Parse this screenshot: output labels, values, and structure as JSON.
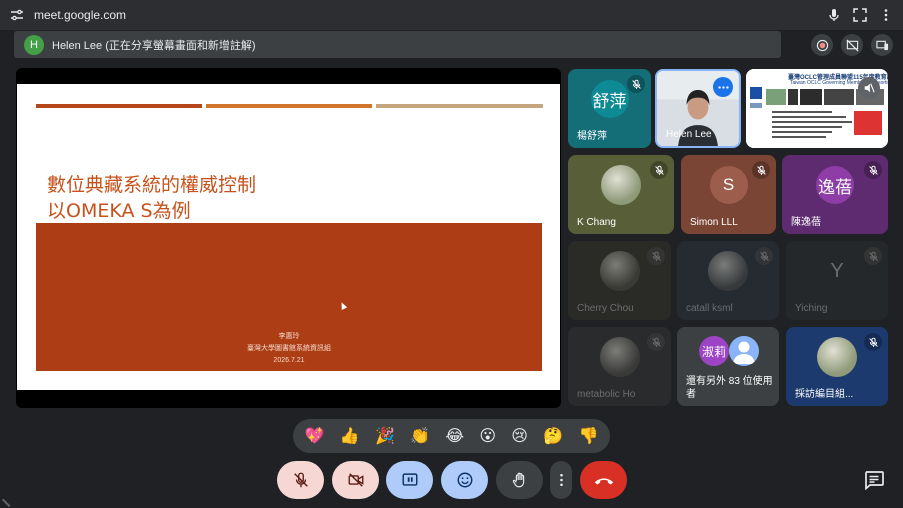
{
  "browser": {
    "url": "meet.google.com"
  },
  "banner": {
    "avatar_letter": "H",
    "text": "Helen Lee (正在分享螢幕畫面和新增註解)"
  },
  "slide": {
    "title_line1": "數位典藏系統的權威控制",
    "title_line2": "以OMEKA S為例",
    "author": "李惠玲",
    "org": "臺灣大學圖書館系統資訊組",
    "date": "2026.7.21",
    "bar_colors": [
      "#b5461b",
      "#d0752a",
      "#c4a57e"
    ]
  },
  "tiles": [
    {
      "id": "tile-1",
      "name": "楊舒萍",
      "letter": "舒萍",
      "bg": "#136e78",
      "avatar_color": "#0e8a94",
      "state": "muted"
    },
    {
      "id": "tile-2",
      "name": "Helen Lee",
      "state": "speaking"
    },
    {
      "id": "tile-3",
      "name": "",
      "state": "screen",
      "screen_title": "臺灣OCLC管理成員聯盟115年度教育訓練",
      "screen_subtitle": "Taiwan OCLC Governing Members Consortium"
    },
    {
      "id": "tile-4",
      "name": "K Chang",
      "bg": "#585e37",
      "state": "muted"
    },
    {
      "id": "tile-5",
      "name": "Simon LLL",
      "letter": "S",
      "bg": "#7a4535",
      "avatar_color": "#9c5d4c",
      "state": "muted"
    },
    {
      "id": "tile-6",
      "name": "陳逸蓓",
      "letter": "逸蓓",
      "bg": "#5f2b70",
      "avatar_color": "#8e3da6",
      "state": "muted"
    },
    {
      "id": "tile-7",
      "name": "Cherry Chou",
      "bg": "#2a2b26",
      "state": "dim"
    },
    {
      "id": "tile-8",
      "name": "catall ksml",
      "bg": "#262a31",
      "state": "dim"
    },
    {
      "id": "tile-9",
      "name": "Yiching",
      "letter": "Y",
      "bg": "#25282a",
      "state": "dim"
    },
    {
      "id": "tile-10",
      "name": "metabolic Ho",
      "bg": "#2a2b2c",
      "state": "dim"
    },
    {
      "id": "tile-11",
      "name": "還有另外 83 位使用者",
      "letter": "淑莉",
      "bg": "#3c4043",
      "state": "overflow"
    },
    {
      "id": "tile-12",
      "name": "採訪編目組...",
      "bg": "#1c3a6e",
      "state": "muted"
    }
  ],
  "reactions": [
    "💖",
    "👍",
    "🎉",
    "👏",
    "😂",
    "😮",
    "😢",
    "🤔",
    "👎"
  ],
  "controls": {
    "mic_bg": "#f6d7d4",
    "cam_bg": "#f6d7d4",
    "present_bg": "#aecbfa",
    "emoji_bg": "#aecbfa",
    "hand_bg": "#3c4043",
    "more_bg": "#3c4043",
    "hangup_bg": "#d93025"
  }
}
